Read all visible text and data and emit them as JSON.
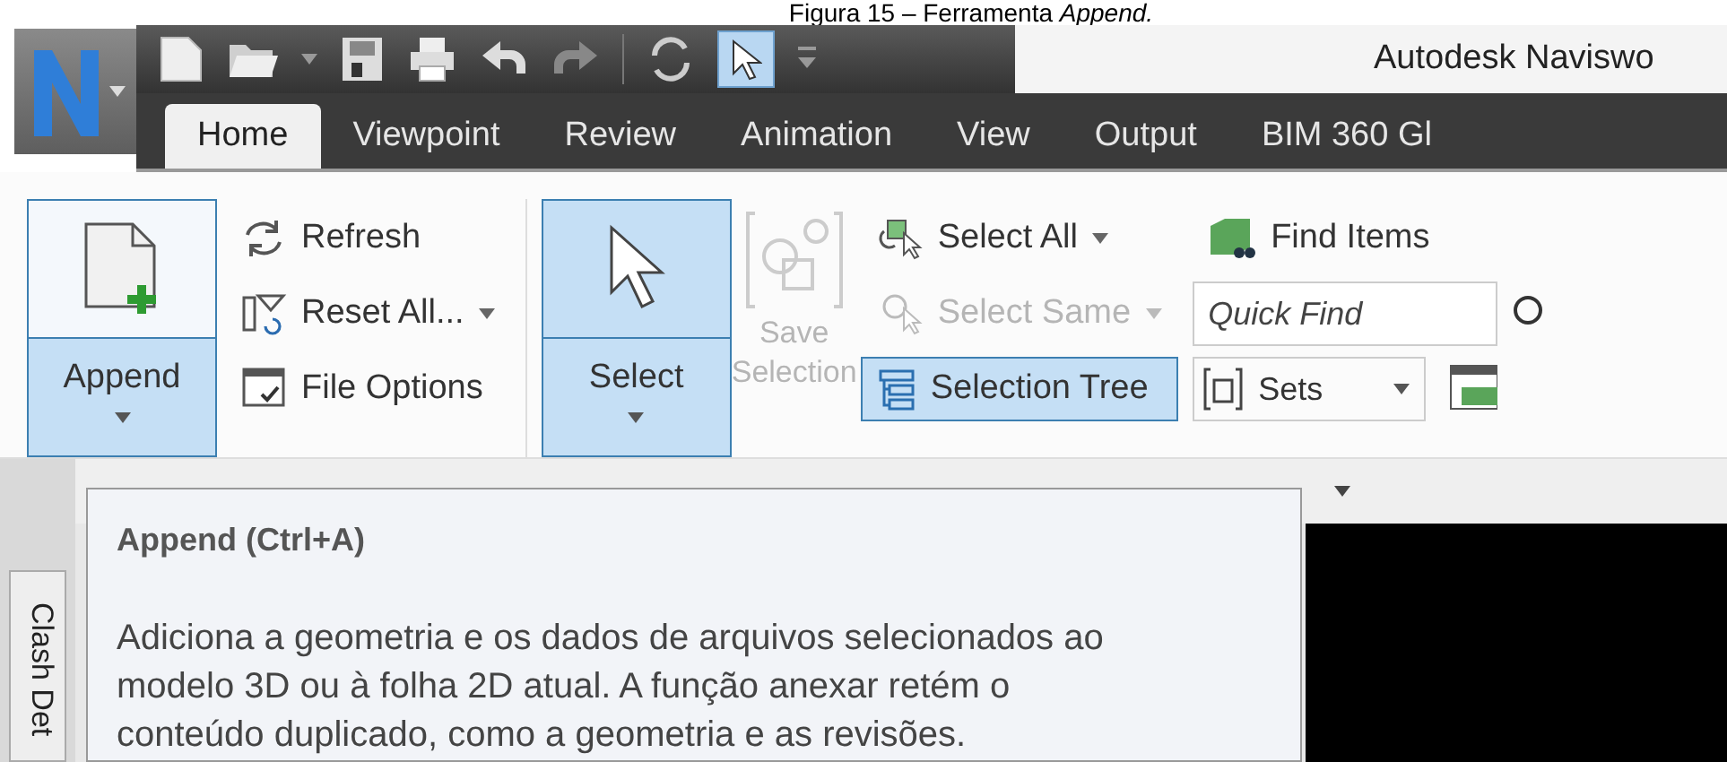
{
  "caption": "Figura 15 – Ferramenta *Append.*",
  "title": "Autodesk Naviswo",
  "tabs": [
    {
      "label": "Home",
      "selected": true
    },
    {
      "label": "Viewpoint",
      "selected": false
    },
    {
      "label": "Review",
      "selected": false
    },
    {
      "label": "Animation",
      "selected": false
    },
    {
      "label": "View",
      "selected": false
    },
    {
      "label": "Output",
      "selected": false
    },
    {
      "label": "BIM 360 Gl",
      "selected": false
    }
  ],
  "append": {
    "label": "Append",
    "active": true
  },
  "file_buttons": [
    {
      "kind": "refresh",
      "label": "Refresh",
      "dropdown": false
    },
    {
      "kind": "reset",
      "label": "Reset All...",
      "dropdown": true
    },
    {
      "kind": "options",
      "label": "File Options",
      "dropdown": false
    }
  ],
  "select": {
    "label": "Select",
    "active": true
  },
  "save_selection": {
    "lines": [
      "Save",
      "Selection"
    ],
    "disabled": true
  },
  "select_buttons": [
    {
      "kind": "select-all",
      "label": "Select All",
      "dropdown": true,
      "disabled": false,
      "active": false
    },
    {
      "kind": "select-same",
      "label": "Select Same",
      "dropdown": true,
      "disabled": true,
      "active": false
    },
    {
      "kind": "tree",
      "label": "Selection Tree",
      "dropdown": false,
      "disabled": false,
      "active": true
    }
  ],
  "find_items": {
    "label": "Find Items"
  },
  "quick_find": {
    "placeholder": "Quick Find"
  },
  "sets": {
    "label": "Sets"
  },
  "side_tab": {
    "label": "Clash Det"
  },
  "tooltip": {
    "title": "Append (Ctrl+A)",
    "text": "Adiciona a geometria e os dados de arquivos selecionados ao modelo 3D ou à folha 2D atual. A função anexar retém o conteúdo duplicado, como a geometria e as revisões."
  }
}
